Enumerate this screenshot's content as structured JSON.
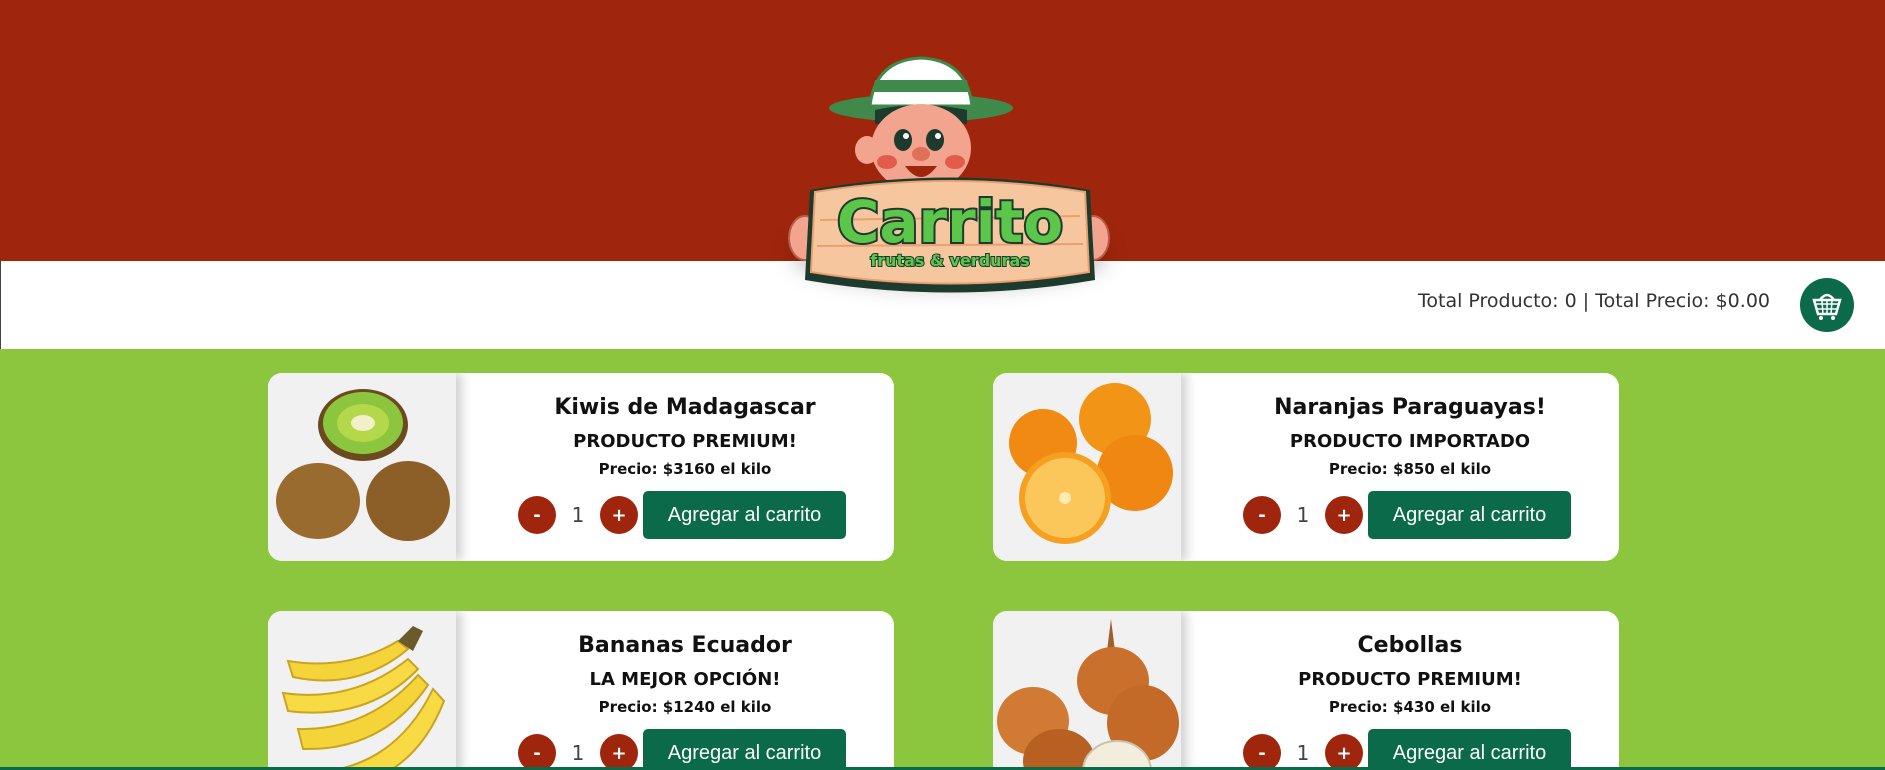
{
  "brand": {
    "logo_text": "Carrito",
    "logo_subtext": "frutas & verduras"
  },
  "colors": {
    "header_red": "#9f260c",
    "page_green": "#8cc63f",
    "accent_dark_green": "#0b6a4a"
  },
  "cart_summary": {
    "text": "Total Producto: 0 | Total Precio: $0.00",
    "icon": "basket-icon"
  },
  "products": [
    {
      "name": "Kiwis de Madagascar",
      "tag": "PRODUCTO PREMIUM!",
      "price": "Precio: $3160 el kilo",
      "minus": "-",
      "qty": "1",
      "plus": "+",
      "add_label": "Agregar al carrito",
      "image": "kiwi-image"
    },
    {
      "name": "Naranjas Paraguayas!",
      "tag": "PRODUCTO IMPORTADO",
      "price": "Precio: $850 el kilo",
      "minus": "-",
      "qty": "1",
      "plus": "+",
      "add_label": "Agregar al carrito",
      "image": "orange-image"
    },
    {
      "name": "Bananas Ecuador",
      "tag": "LA MEJOR OPCIÓN!",
      "price": "Precio: $1240 el kilo",
      "minus": "-",
      "qty": "1",
      "plus": "+",
      "add_label": "Agregar al carrito",
      "image": "banana-image"
    },
    {
      "name": "Cebollas",
      "tag": "PRODUCTO PREMIUM!",
      "price": "Precio: $430 el kilo",
      "minus": "-",
      "qty": "1",
      "plus": "+",
      "add_label": "Agregar al carrito",
      "image": "onion-image"
    }
  ]
}
